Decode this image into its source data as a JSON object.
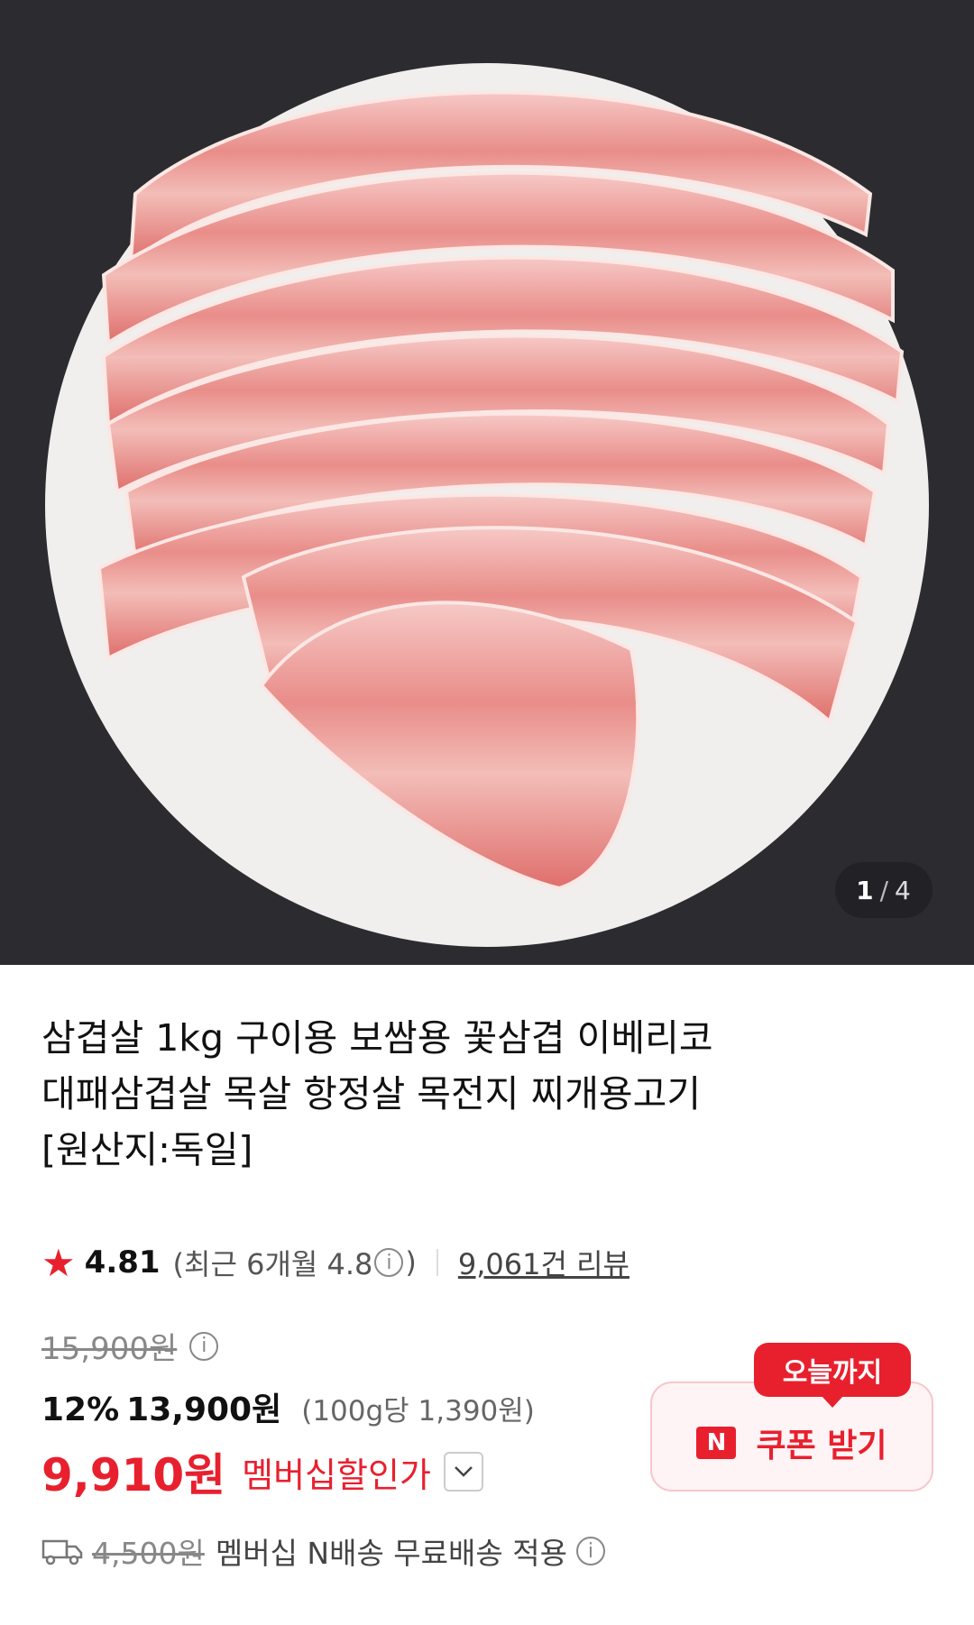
{
  "hero": {
    "image_counter": {
      "current": "1",
      "separator": "/",
      "total": "4"
    }
  },
  "product": {
    "title_lines": [
      "삼겹살 1kg 구이용 보쌈용 꽃삼겹 이베리코",
      "대패삼겹살 목살 항정살 목전지 찌개용고기",
      "[원산지:독일]"
    ]
  },
  "rating": {
    "star_icon": "star-icon",
    "score": "4.81",
    "recent_prefix": "(최근 6개월 4.8",
    "recent_suffix": ")",
    "review_count": "9,061건 리뷰"
  },
  "price": {
    "original": "15,900원",
    "discount_percent": "12%",
    "sale_price": "13,900원",
    "unit_price": "(100g당 1,390원)",
    "member_price": "9,910원",
    "member_label": "멤버십할인가"
  },
  "coupon": {
    "badge": "오늘까지",
    "logo": "N",
    "label": "쿠폰 받기"
  },
  "shipping": {
    "original_fee": "4,500원",
    "label": "멤버십 N배송 무료배송 적용"
  },
  "colors": {
    "accent": "#e8202e",
    "hero_bg": "#2c2c30"
  }
}
